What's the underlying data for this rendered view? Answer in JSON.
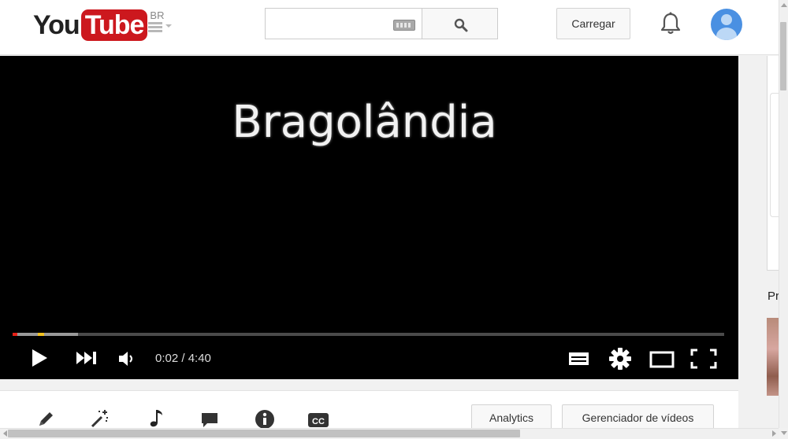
{
  "header": {
    "logo_you": "You",
    "logo_tube": "Tube",
    "logo_country": "BR",
    "search_value": "",
    "upload_label": "Carregar"
  },
  "player": {
    "title": "Bragolândia",
    "time": "0:02 / 4:40",
    "progress_fraction": 0.007,
    "buffered_fraction": 0.092,
    "colors": {
      "played": "#e62117",
      "loaded": "#999999",
      "marker": "#f0c020"
    }
  },
  "right_rail": {
    "label_fragment": "Pr"
  },
  "creator_bar": {
    "tools": [
      "pencil-icon",
      "magic-wand-icon",
      "music-note-icon",
      "comment-icon",
      "info-icon",
      "cc-icon"
    ],
    "analytics_label": "Analytics",
    "video_manager_label": "Gerenciador de vídeos"
  },
  "icons": {
    "play": "play-icon",
    "next": "next-icon",
    "volume": "volume-icon",
    "subtitles": "subtitles-icon",
    "settings": "gear-icon",
    "theater": "theater-mode-icon",
    "fullscreen": "fullscreen-icon"
  }
}
